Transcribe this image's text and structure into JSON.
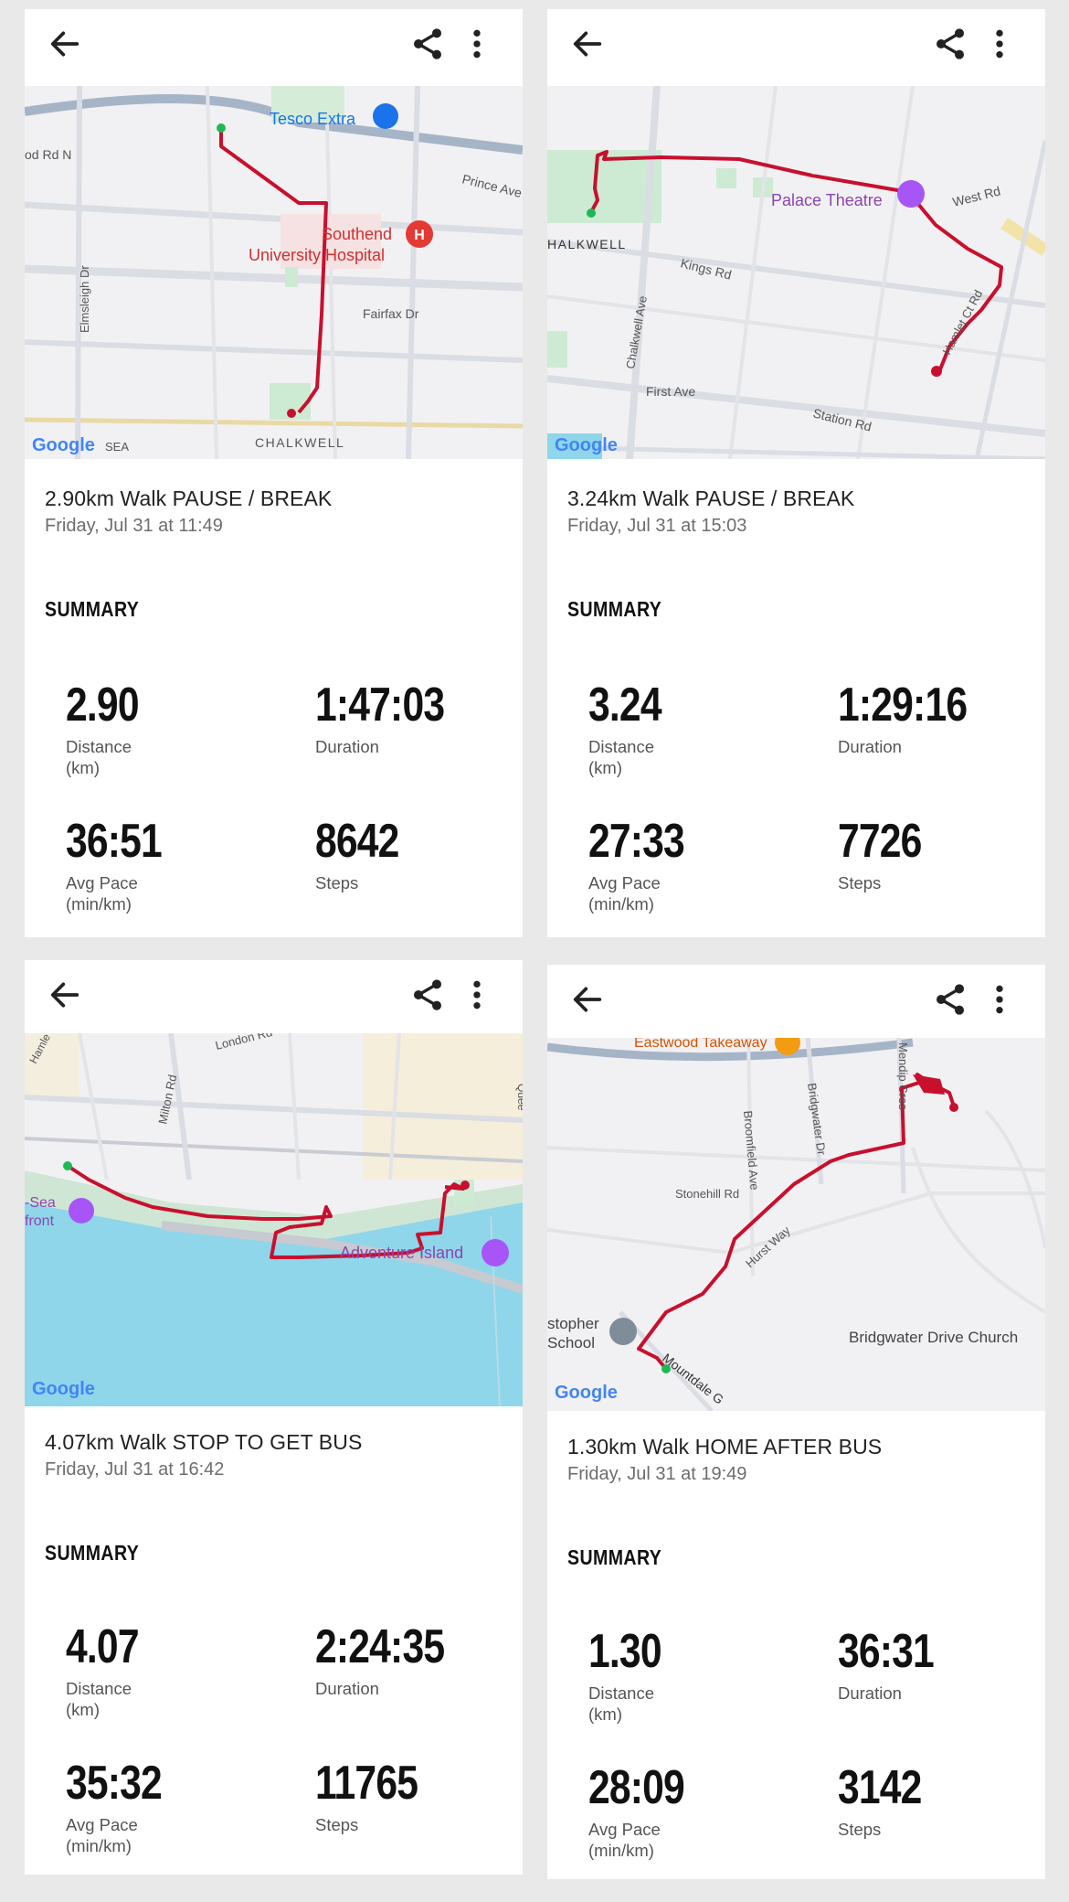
{
  "cards": [
    {
      "title": "2.90km Walk PAUSE / BREAK",
      "date": "Friday, Jul 31 at 11:49",
      "summary_heading": "SUMMARY",
      "distance": "2.90",
      "distance_label": "Distance",
      "distance_unit": "(km)",
      "duration": "1:47:03",
      "duration_label": "Duration",
      "pace": "36:51",
      "pace_label": "Avg Pace",
      "pace_unit": "(min/km)",
      "steps": "8642",
      "steps_label": "Steps",
      "map_labels": {
        "a": "Tesco Extra",
        "b": "Prince Ave",
        "c": "od Rd N",
        "d": "Southend",
        "e": "University Hospital",
        "f": "Elmsleigh Dr",
        "g": "Fairfax Dr",
        "h": "CHALKWELL",
        "i": "SEA",
        "logo": "Google"
      }
    },
    {
      "title": "3.24km Walk PAUSE / BREAK",
      "date": "Friday, Jul 31 at 15:03",
      "summary_heading": "SUMMARY",
      "distance": "3.24",
      "distance_label": "Distance",
      "distance_unit": "(km)",
      "duration": "1:29:16",
      "duration_label": "Duration",
      "pace": "27:33",
      "pace_label": "Avg Pace",
      "pace_unit": "(min/km)",
      "steps": "7726",
      "steps_label": "Steps",
      "map_labels": {
        "a": "Palace Theatre",
        "b": "West Rd",
        "c": "HALKWELL",
        "d": "Kings Rd",
        "e": "Chalkwell Ave",
        "f": "Hamlet Ct Rd",
        "g": "First Ave",
        "h": "Station Rd",
        "logo": "Google"
      }
    },
    {
      "title": "4.07km Walk STOP TO GET BUS",
      "date": "Friday, Jul 31 at 16:42",
      "summary_heading": "SUMMARY",
      "distance": "4.07",
      "distance_label": "Distance",
      "distance_unit": "(km)",
      "duration": "2:24:35",
      "duration_label": "Duration",
      "pace": "35:32",
      "pace_label": "Avg Pace",
      "pace_unit": "(min/km)",
      "steps": "11765",
      "steps_label": "Steps",
      "map_labels": {
        "a": "London Rd",
        "b": "Milton Rd",
        "c": "Hamle",
        "d": "-Sea",
        "e": "front",
        "f": "Adventure Island",
        "g": "Quee",
        "logo": "Google"
      }
    },
    {
      "title": "1.30km Walk HOME AFTER BUS",
      "date": "Friday, Jul 31 at 19:49",
      "summary_heading": "SUMMARY",
      "distance": "1.30",
      "distance_label": "Distance",
      "distance_unit": "(km)",
      "duration": "36:31",
      "duration_label": "Duration",
      "pace": "28:09",
      "pace_label": "Avg Pace",
      "pace_unit": "(min/km)",
      "steps": "3142",
      "steps_label": "Steps",
      "map_labels": {
        "a": "Eastwood Takeaway",
        "b": "Mendip Cres",
        "c": "Broomfield Ave",
        "d": "Bridgwater Dr",
        "e": "Stonehill Rd",
        "f": "Hurst Way",
        "g": "stopher",
        "h": "School",
        "i": "Bridgwater Drive Church",
        "j": "Mountdale G",
        "logo": "Google"
      }
    }
  ],
  "colors": {
    "route": "#c8102e",
    "start": "#1db954",
    "map_bg": "#f1f1f3",
    "water": "#8fd6ea",
    "park": "#cdebd3"
  }
}
